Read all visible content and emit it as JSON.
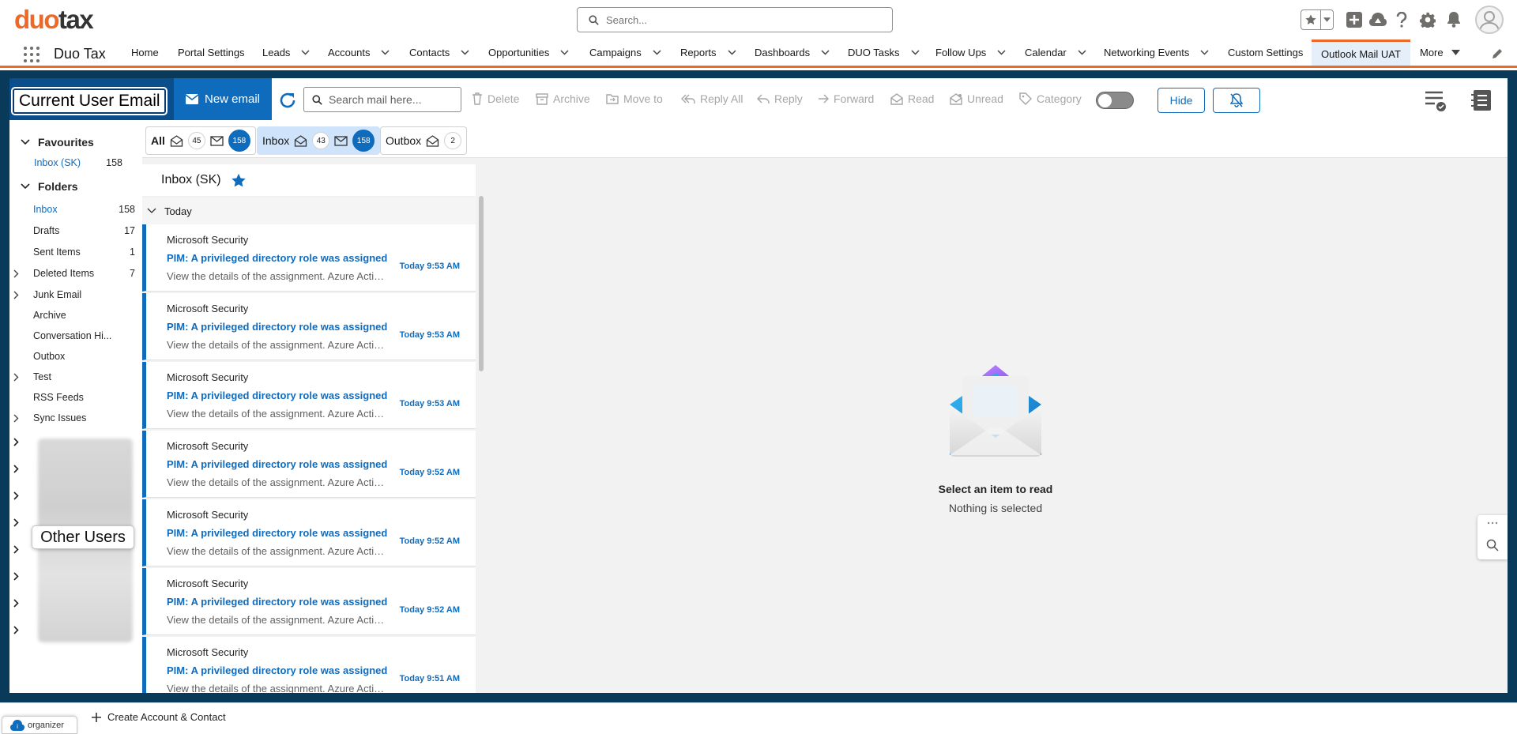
{
  "header": {
    "logo_part1": "duo",
    "logo_part2": "tax",
    "search_placeholder": "Search..."
  },
  "nav": {
    "app_name": "Duo Tax",
    "items": [
      {
        "label": "Home",
        "chevron": false
      },
      {
        "label": "Portal Settings",
        "chevron": false
      },
      {
        "label": "Leads",
        "chevron": true
      },
      {
        "label": "Accounts",
        "chevron": true
      },
      {
        "label": "Contacts",
        "chevron": true
      },
      {
        "label": "Opportunities",
        "chevron": true
      },
      {
        "label": "Campaigns",
        "chevron": true
      },
      {
        "label": "Reports",
        "chevron": true
      },
      {
        "label": "Dashboards",
        "chevron": true
      },
      {
        "label": "DUO Tasks",
        "chevron": true
      },
      {
        "label": "Follow Ups",
        "chevron": true
      },
      {
        "label": "Calendar",
        "chevron": true
      },
      {
        "label": "Networking Events",
        "chevron": true
      },
      {
        "label": "Custom Settings",
        "chevron": false
      },
      {
        "label": "Outlook Mail UAT",
        "chevron": false,
        "active": true
      },
      {
        "label": "More",
        "chevron": true
      }
    ]
  },
  "toolbar": {
    "current_user_email": "Current User Email",
    "new_email": "New email",
    "search_mail_placeholder": "Search mail here...",
    "delete": "Delete",
    "archive": "Archive",
    "move_to": "Move to",
    "reply_all": "Reply All",
    "reply": "Reply",
    "forward": "Forward",
    "read": "Read",
    "unread": "Unread",
    "category": "Category",
    "hide": "Hide"
  },
  "sidebar": {
    "favourites_label": "Favourites",
    "favourites": [
      {
        "label": "Inbox (SK)",
        "count": "158",
        "selected": true
      }
    ],
    "folders_label": "Folders",
    "folders": [
      {
        "label": "Inbox",
        "count": "158",
        "selected": true,
        "expandable": false
      },
      {
        "label": "Drafts",
        "count": "17",
        "expandable": false
      },
      {
        "label": "Sent Items",
        "count": "1",
        "expandable": false
      },
      {
        "label": "Deleted Items",
        "count": "7",
        "expandable": true
      },
      {
        "label": "Junk Email",
        "count": "",
        "expandable": true
      },
      {
        "label": "Archive",
        "count": "",
        "expandable": false
      },
      {
        "label": "Conversation Hi...",
        "count": "",
        "expandable": false
      },
      {
        "label": "Outbox",
        "count": "",
        "expandable": false
      },
      {
        "label": "Test",
        "count": "",
        "expandable": true
      },
      {
        "label": "RSS Feeds",
        "count": "",
        "expandable": false
      },
      {
        "label": "Sync Issues",
        "count": "",
        "expandable": true
      }
    ],
    "other_users_label": "Other Users"
  },
  "tabs": [
    {
      "label": "All",
      "unread": "45",
      "total": "158"
    },
    {
      "label": "Inbox",
      "unread": "43",
      "total": "158",
      "selected": true
    },
    {
      "label": "Outbox",
      "unread": "2"
    }
  ],
  "mail_list": {
    "folder_title": "Inbox (SK)",
    "group_label": "Today",
    "messages": [
      {
        "sender": "Microsoft Security",
        "subject": "PIM: A privileged directory role was assigned",
        "preview": "View the details of the assignment. Azure Active Directory",
        "time": "Today 9:53 AM"
      },
      {
        "sender": "Microsoft Security",
        "subject": "PIM: A privileged directory role was assigned",
        "preview": "View the details of the assignment. Azure Active Directory",
        "time": "Today 9:53 AM"
      },
      {
        "sender": "Microsoft Security",
        "subject": "PIM: A privileged directory role was assigned",
        "preview": "View the details of the assignment. Azure Active Directory",
        "time": "Today 9:53 AM"
      },
      {
        "sender": "Microsoft Security",
        "subject": "PIM: A privileged directory role was assigned",
        "preview": "View the details of the assignment. Azure Active Directory",
        "time": "Today 9:52 AM"
      },
      {
        "sender": "Microsoft Security",
        "subject": "PIM: A privileged directory role was assigned",
        "preview": "View the details of the assignment. Azure Active Directory",
        "time": "Today 9:52 AM"
      },
      {
        "sender": "Microsoft Security",
        "subject": "PIM: A privileged directory role was assigned",
        "preview": "View the details of the assignment. Azure Active Directory",
        "time": "Today 9:52 AM"
      },
      {
        "sender": "Microsoft Security",
        "subject": "PIM: A privileged directory role was assigned",
        "preview": "View the details of the assignment. Azure Active Directory",
        "time": "Today 9:51 AM"
      }
    ]
  },
  "reading_pane": {
    "title": "Select an item to read",
    "subtitle": "Nothing is selected"
  },
  "footer": {
    "organizer_label": "organizer",
    "create_label": "Create Account & Contact"
  },
  "colors": {
    "brand_orange": "#ec6a29",
    "outlook_blue": "#0f6cbd",
    "frame_navy": "#0a3a5a"
  }
}
